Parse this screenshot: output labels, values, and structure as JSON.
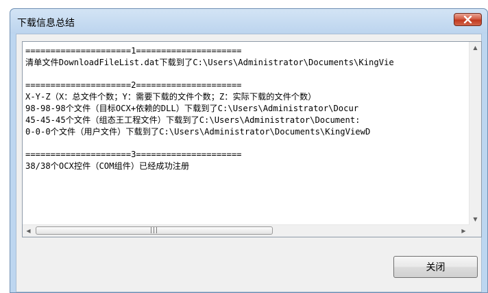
{
  "window": {
    "title": "下载信息总结"
  },
  "log": {
    "lines": [
      "=====================1=====================",
      "清单文件DownloadFileList.dat下载到了C:\\Users\\Administrator\\Documents\\KingVie",
      "",
      "=====================2=====================",
      "X-Y-Z（X：总文件个数；Y：需要下载的文件个数；Z：实际下载的文件个数）",
      "98-98-98个文件（目标OCX+依赖的DLL）下载到了C:\\Users\\Administrator\\Docur",
      "45-45-45个文件（组态王工程文件）下载到了C:\\Users\\Administrator\\Document:",
      "0-0-0个文件（用户文件）下载到了C:\\Users\\Administrator\\Documents\\KingViewD",
      "",
      "=====================3=====================",
      "38/38个OCX控件（COM组件）已经成功注册"
    ]
  },
  "buttons": {
    "close_label": "关闭"
  },
  "icons": {
    "close": "close-x-icon",
    "scroll_up": "scroll-up-arrow-icon",
    "scroll_down": "scroll-down-arrow-icon",
    "scroll_left": "scroll-left-arrow-icon",
    "scroll_right": "scroll-right-arrow-icon",
    "grip": "scrollbar-grip-icon"
  },
  "colors": {
    "close_button": "#c7442b",
    "frame": "#bdd6f0"
  }
}
